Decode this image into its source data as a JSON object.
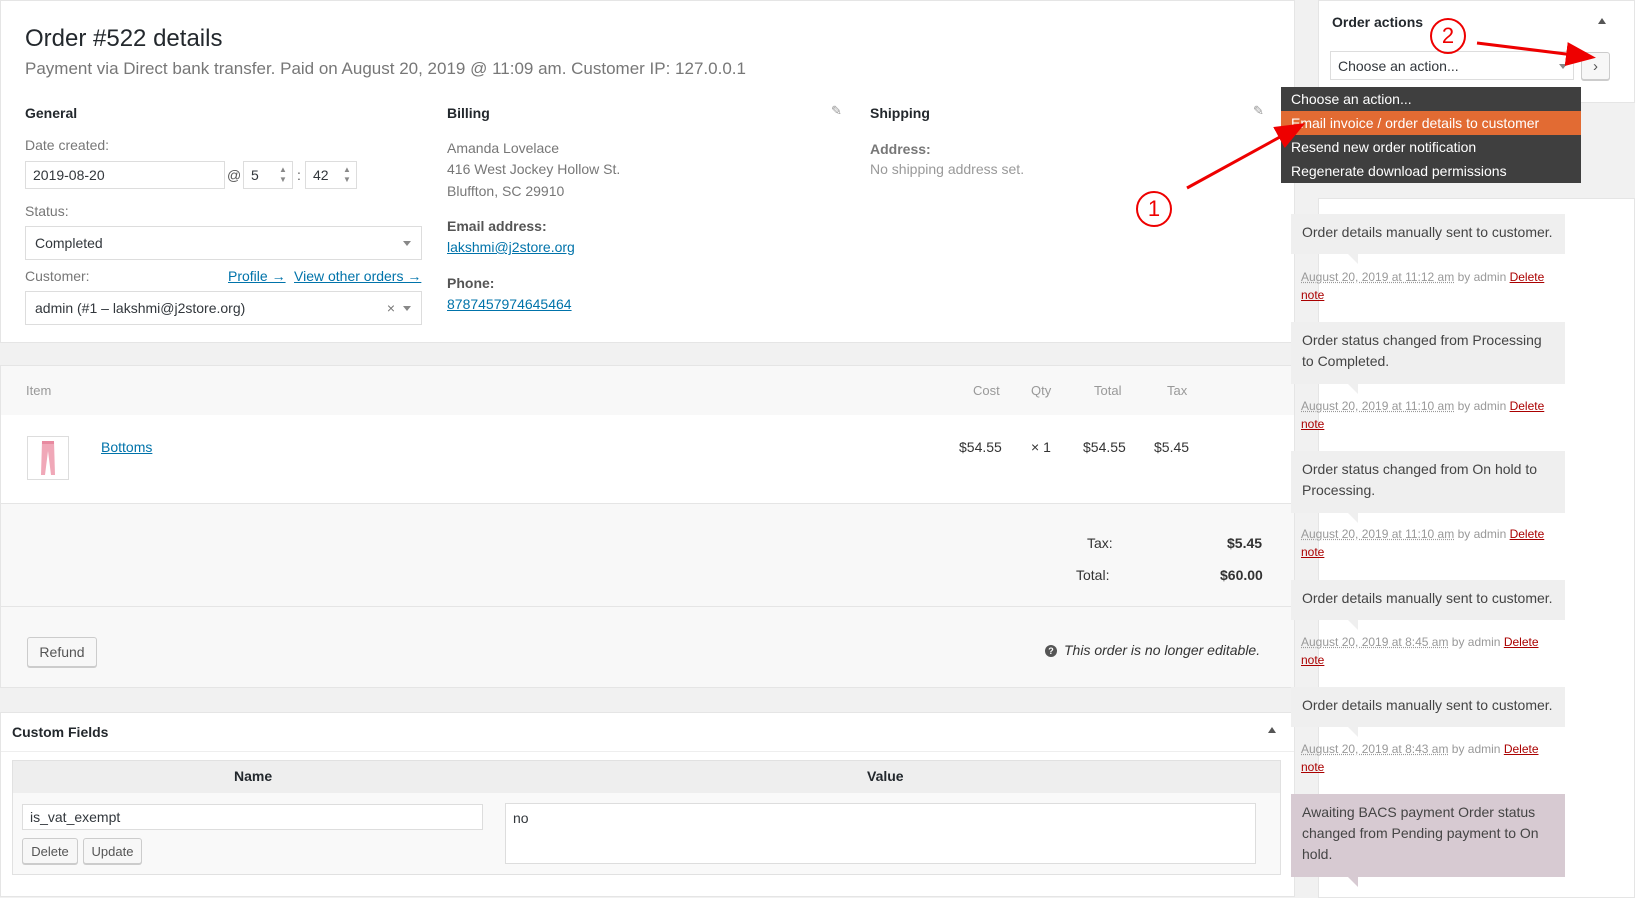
{
  "order": {
    "title": "Order #522 details",
    "subtitle": "Payment via Direct bank transfer. Paid on August 20, 2019 @ 11:09 am. Customer IP: 127.0.0.1"
  },
  "general": {
    "heading": "General",
    "date_label": "Date created:",
    "date_value": "2019-08-20",
    "at": "@",
    "hour": "5",
    "colon": ":",
    "minute": "42",
    "status_label": "Status:",
    "status_value": "Completed",
    "customer_label": "Customer:",
    "profile_link": "Profile →",
    "other_orders_link": "View other orders →",
    "customer_value": "admin (#1 – lakshmi@j2store.org)",
    "clear": "×"
  },
  "billing": {
    "heading": "Billing",
    "name": "Amanda Lovelace",
    "street": "416 West Jockey Hollow St.",
    "city": "Bluffton, SC 29910",
    "email_label": "Email address:",
    "email": "lakshmi@j2store.org",
    "phone_label": "Phone:",
    "phone": "8787457974645464"
  },
  "shipping": {
    "heading": "Shipping",
    "address_label": "Address:",
    "address_value": "No shipping address set."
  },
  "items": {
    "headers": {
      "item": "Item",
      "cost": "Cost",
      "qty": "Qty",
      "total": "Total",
      "tax": "Tax"
    },
    "rows": [
      {
        "name": "Bottoms",
        "cost": "$54.55",
        "qty": "× 1",
        "total": "$54.55",
        "tax": "$5.45"
      }
    ],
    "tax_label": "Tax:",
    "tax_value": "$5.45",
    "total_label": "Total:",
    "total_value": "$60.00",
    "refund_button": "Refund",
    "not_editable": "This order is no longer editable."
  },
  "custom_fields": {
    "heading": "Custom Fields",
    "name_header": "Name",
    "value_header": "Value",
    "field_name": "is_vat_exempt",
    "field_value": "no",
    "delete_button": "Delete",
    "update_button": "Update"
  },
  "order_actions": {
    "heading": "Order actions",
    "select_value": "Choose an action...",
    "go": "›",
    "options": [
      "Choose an action...",
      "Email invoice / order details to customer",
      "Resend new order notification",
      "Regenerate download permissions"
    ]
  },
  "notes": [
    {
      "text": "Order details manually sent to customer.",
      "date": "August 20, 2019 at 11:12 am",
      "by": " by admin ",
      "delete1": "Delete",
      "delete2": "note"
    },
    {
      "text": "Order status changed from Processing to Completed.",
      "date": "August 20, 2019 at 11:10 am",
      "by": " by admin ",
      "delete1": "Delete",
      "delete2": "note"
    },
    {
      "text": "Order status changed from On hold to Processing.",
      "date": "August 20, 2019 at 11:10 am",
      "by": " by admin ",
      "delete1": "Delete",
      "delete2": "note"
    },
    {
      "text": "Order details manually sent to customer.",
      "date": "August 20, 2019 at 8:45 am",
      "by": " by admin ",
      "delete1": "Delete",
      "delete2": "note"
    },
    {
      "text": "Order details manually sent to customer.",
      "date": "August 20, 2019 at 8:43 am",
      "by": " by admin ",
      "delete1": "Delete",
      "delete2": "note"
    },
    {
      "text": "Awaiting BACS payment Order status changed from Pending payment to On hold."
    }
  ],
  "annotations": {
    "one": "1",
    "two": "2",
    "color": "#ee0000"
  }
}
